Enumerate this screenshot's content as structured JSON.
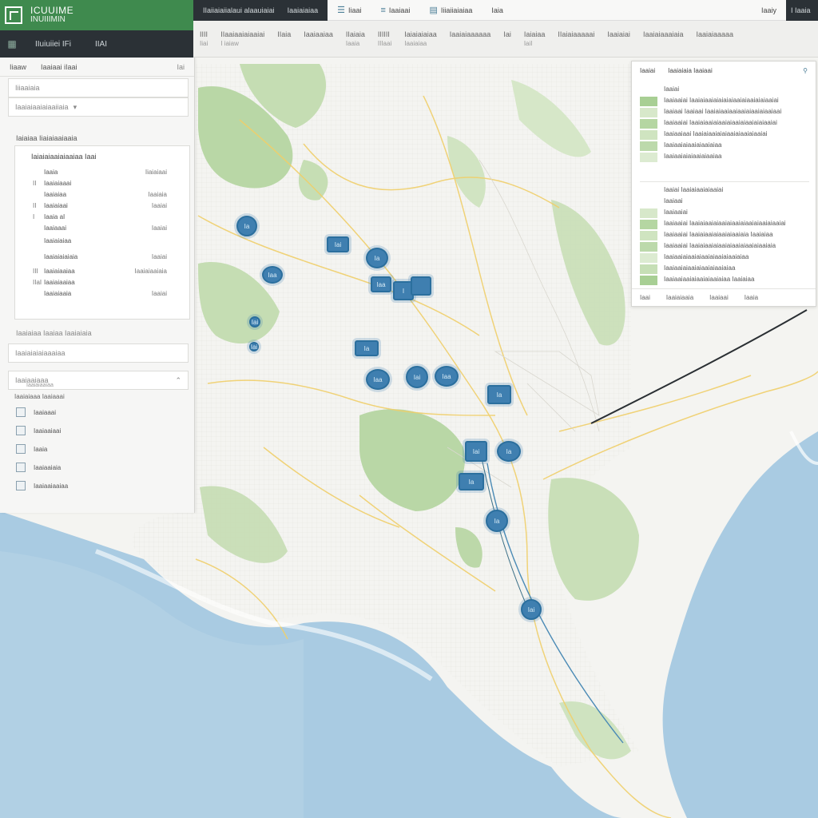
{
  "brand": {
    "title": "ICUUIME",
    "subtitle": "INUIIIMIN"
  },
  "subbar": {
    "icon": "grid-icon",
    "label": "IIuiuiiei IFi",
    "right": "IIAI"
  },
  "topnav": {
    "dark_item": "IIaiiaiaiialaui alaauiaiai",
    "dark_item2": "Iaaiaiaiaa",
    "items": [
      {
        "icon": "list-icon",
        "label": "Iiaai"
      },
      {
        "icon": "menu-icon",
        "label": "Iaaiaai"
      },
      {
        "icon": "layers-icon",
        "label": "Iiiaiiaiaiaa"
      },
      {
        "icon": "",
        "label": "Iaia"
      }
    ],
    "right_label": "Iaaiy",
    "end_label": "I Iaaia"
  },
  "toolbar": {
    "tools": [
      {
        "label": "IIII",
        "sub": "Iiai"
      },
      {
        "label": "IIaaiaaiaiaaiai",
        "sub": "I iaiaw"
      },
      {
        "label": "IIaia",
        "sub": ""
      },
      {
        "label": "Iaaiaaiaa",
        "sub": ""
      },
      {
        "label": "IIaiaia",
        "sub": "Iaaia"
      },
      {
        "label": "IIIIII",
        "sub": "IIIaai"
      },
      {
        "label": "Iaiaiaiaiaa",
        "sub": "Iaaiaiaa"
      },
      {
        "label": "Iaaiaiaaaaaa",
        "sub": ""
      },
      {
        "label": "Iai",
        "sub": ""
      },
      {
        "label": "Iaiaiaa",
        "sub": "IaiI"
      },
      {
        "label": "IIaiaiaaaaai",
        "sub": ""
      },
      {
        "label": "Iaaiaiai",
        "sub": ""
      },
      {
        "label": "Iaaiaiaaaiaia",
        "sub": ""
      },
      {
        "label": "Iaaiaiaaaaa",
        "sub": ""
      }
    ]
  },
  "left_panel": {
    "tabs": [
      "Iiaaw",
      "Iaaiaai iIaai"
    ],
    "close": "Iai",
    "input1": "Iiiaaiaia",
    "input2": "Iaaiaiaaiaiaaiiaia",
    "section": "Iaiaiaa Iiaiaiaaiaaia",
    "card_title": "Iaiaiaiaaiaiaaiaa Iaai",
    "rows": [
      {
        "n": "",
        "l": "Iaaia",
        "r": "Iiaiaiaai"
      },
      {
        "n": "II",
        "l": "Iaaiaiaaai",
        "r": ""
      },
      {
        "n": "",
        "l": "Iaaiaiaa",
        "r": "Iaaiaia"
      },
      {
        "n": "II",
        "l": "Iaaiaiaai",
        "r": "Iaaiai"
      },
      {
        "n": "I",
        "l": "Iaaia aI",
        "r": ""
      },
      {
        "n": "",
        "l": "Iaaiaaai",
        "r": "Iaaiai"
      },
      {
        "n": "",
        "l": "Iaaiaiaiaa",
        "r": ""
      },
      {
        "n": "",
        "l": "Iaaiaiaiaiaia",
        "r": "Iaaiai"
      },
      {
        "n": "III",
        "l": "Iaaiaiaaiaa",
        "r": "Iaaiaiaaiaia"
      },
      {
        "n": "IIaI",
        "l": "Iaaiaiaaiaa",
        "r": ""
      },
      {
        "n": "",
        "l": "Iaaiaiaaia",
        "r": "Iaaiai"
      }
    ],
    "footer": "Iaaiaiaa Iaaiaa Iaaiaiaia",
    "search2": "Iaaiaiaiaiaaaiaa",
    "dropdown": "Iaaiaaiaaa",
    "dropdown_sub": "Iaaiaiaaiaa",
    "dropdown_caption": "Iaaiaiaaa Iaaiaaai",
    "items": [
      "Iaaiaaai",
      "Iaaiaaiaai",
      "Iaaia",
      "Iaaiaaiaia",
      "Iaaiaaiaaiaa"
    ]
  },
  "right_panel": {
    "tabs": [
      "Iaaiai",
      "Iaaiaiaia Iaaiaai"
    ],
    "close_icon": "filter-icon",
    "lines_top": [
      "Iaaiai",
      "Iaaiaaiai Iaaiaiaaiaiaiaiaiaaiaiaaiaiaiaaiai",
      "Iaaiaai Iaaiaai Iaaiaiaaiaaiaaiaiaaiaiaaiaai",
      "Iaaiaaiai Iaaiaiaaiaiaaiaiaaiaiaaiaiaiaaiai",
      "Iaaiaaiaai Iaaiaiaaiaiaiaaiaiaaiaiaaiai",
      "Iaaiaaiaiaaiaiaaiaiaa",
      "Iaaiaaiaiaiaaiaiaaiaa"
    ],
    "lines_bottom": [
      "Iaaiai Iaaiaiaaiaiaaiai",
      "Iaaiaai",
      "Iaaiaaiai",
      "Iaaiaaiai Iaaiaiaaiaiaaiaiaaiaiaaiaiaaiaiaaiai",
      "Iaaiaaiai Iaaiaiaaiaiaaiaiaaiaia Iaaiaiaa",
      "Iaaiaaiai Iaaiaiaaiaiaaiaiaaiaiaaiaiaaiaia",
      "Iaaiaaiaiaaiaiaaiaiaaiaiaaiaiaa",
      "Iaaiaaiaiaaiaiaaiaiaaiaiaa",
      "Iaaiaaiaaiaiaaiaiaaiaiaa Iaaiaiaa"
    ],
    "footer": [
      "Iaai",
      "Iaaiaiaaia",
      "Iaaiaai",
      "Iaaia"
    ]
  },
  "markers": [
    {
      "label": "Ia"
    },
    {
      "label": "Iai"
    },
    {
      "label": "Ia"
    },
    {
      "label": "Iaa"
    },
    {
      "label": "Iaa"
    },
    {
      "label": "I"
    },
    {
      "label": ""
    },
    {
      "label": "Iai"
    },
    {
      "label": "Ia"
    },
    {
      "label": "Iai"
    },
    {
      "label": "Iaa"
    },
    {
      "label": "Iai"
    },
    {
      "label": "Iaa"
    },
    {
      "label": "Ia"
    },
    {
      "label": "Iai"
    },
    {
      "label": "Ia"
    },
    {
      "label": "Ia"
    }
  ],
  "colors": {
    "brand_green": "#3f8a4e",
    "dark": "#2b3136",
    "marker_blue": "#3f7fb0",
    "water": "#a9cbe2",
    "park": "#b9d7a6",
    "road_yellow": "#f0cf6a"
  }
}
